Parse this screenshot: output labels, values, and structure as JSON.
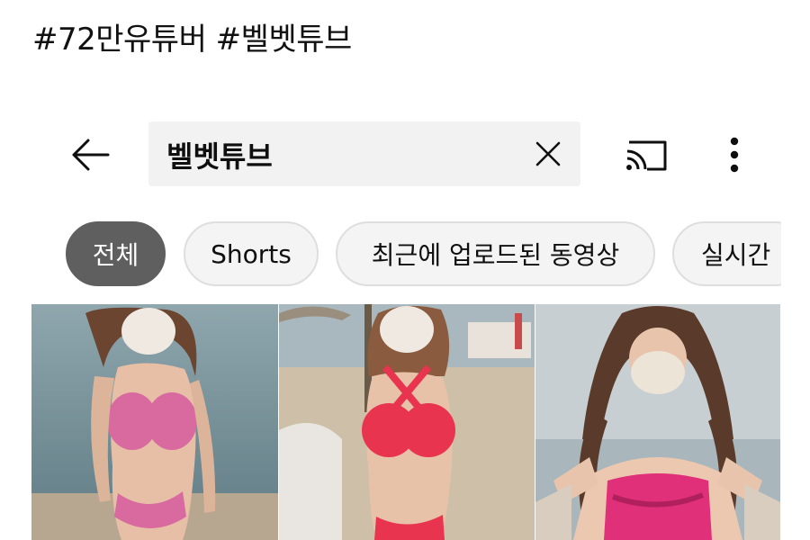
{
  "post": {
    "tags": "#72만유튜버 #벨벳튜브"
  },
  "search": {
    "query": "벨벳튜브"
  },
  "icons": {
    "back": "arrow-back-icon",
    "clear": "close-icon",
    "cast": "cast-icon",
    "more": "more-vert-icon"
  },
  "filters": {
    "chips": [
      {
        "label": "전체",
        "selected": true
      },
      {
        "label": "Shorts",
        "selected": false
      },
      {
        "label": "최근에 업로드된 동영상",
        "selected": false
      },
      {
        "label": "실시간",
        "selected": false
      }
    ]
  },
  "results": {
    "thumbnails": [
      {
        "scene": "beach-water",
        "swimwear_color": "#d86aa0"
      },
      {
        "scene": "beach-umbrellas",
        "swimwear_color": "#e8344f"
      },
      {
        "scene": "overcast-sea",
        "swimwear_color": "#e1307a"
      }
    ]
  },
  "colors": {
    "chip_active_bg": "#5f5f5f",
    "chip_bg": "#f4f4f4",
    "search_bg": "#f2f2f2",
    "text": "#0f0f0f"
  }
}
